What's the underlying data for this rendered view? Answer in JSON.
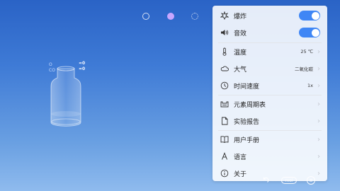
{
  "mode_selector": {
    "modes": [
      "mode-outline",
      "mode-active",
      "mode-dotted"
    ]
  },
  "workspace": {
    "formula_left": [
      "O",
      "CO"
    ],
    "formula_right": [
      "≈0",
      "≈0"
    ]
  },
  "settings_menu": {
    "items": [
      {
        "label": "爆炸",
        "icon": "explosion-icon",
        "type": "toggle",
        "checked": true
      },
      {
        "label": "音效",
        "icon": "speaker-icon",
        "type": "toggle",
        "checked": true
      },
      {
        "label": "温度",
        "icon": "thermometer-icon",
        "value": "25 ℃"
      },
      {
        "label": "大气",
        "icon": "cloud-icon",
        "value": "二氧化碳"
      },
      {
        "label": "时间速度",
        "icon": "clock-icon",
        "value": "1x"
      },
      {
        "label": "元素周期表",
        "icon": "periodic-table-icon",
        "value": ""
      },
      {
        "label": "实验报告",
        "icon": "document-icon",
        "value": ""
      },
      {
        "label": "用户手册",
        "icon": "book-icon",
        "value": ""
      },
      {
        "label": "语言",
        "icon": "language-icon",
        "value": ""
      },
      {
        "label": "关于",
        "icon": "info-icon",
        "value": ""
      }
    ]
  },
  "bottom_bar": {
    "unit_label": "mol",
    "undo_icon": "undo-icon",
    "menu_icon": "menu-icon"
  },
  "colors": {
    "background_top": "#2a63c6",
    "background_bottom": "#8fbbee",
    "toggle_on": "#3f86f5",
    "active_mode": "#c8a6ff"
  }
}
